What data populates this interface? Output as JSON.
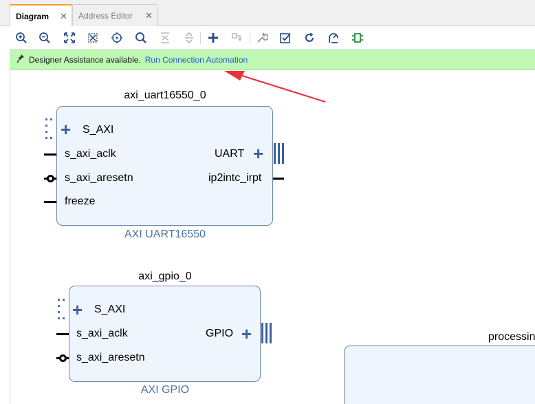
{
  "tabs": [
    {
      "label": "Diagram",
      "close": "✕"
    },
    {
      "label": "Address Editor",
      "close": "✕"
    }
  ],
  "toolbar": {
    "icons": [
      "zoom-in-icon",
      "zoom-out-icon",
      "zoom-fit-icon",
      "fit-selection-icon",
      "center-icon",
      "search-icon",
      "collapse-icon",
      "expand-icon",
      "add-ip-icon",
      "make-connection-icon",
      "properties-icon",
      "validate-icon",
      "regenerate-icon",
      "optimize-icon",
      "layout-icon"
    ]
  },
  "banner": {
    "message": "Designer Assistance available.",
    "link": "Run Connection Automation",
    "background": "#bff7b5"
  },
  "blocks": {
    "uart": {
      "instance": "axi_uart16550_0",
      "type": "AXI UART16550",
      "ports_left": [
        "S_AXI",
        "s_axi_aclk",
        "s_axi_aresetn",
        "freeze"
      ],
      "ports_right": [
        "UART",
        "ip2intc_irpt"
      ]
    },
    "gpio": {
      "instance": "axi_gpio_0",
      "type": "AXI GPIO",
      "ports_left": [
        "S_AXI",
        "s_axi_aclk",
        "s_axi_aresetn"
      ],
      "ports_right": [
        "GPIO"
      ]
    },
    "ps": {
      "instance": "processin"
    }
  },
  "colors": {
    "block_fill": "#eef5fd",
    "block_border": "#6b86a9",
    "accent": "#3a5f9c",
    "arrow": "#e8333a"
  }
}
